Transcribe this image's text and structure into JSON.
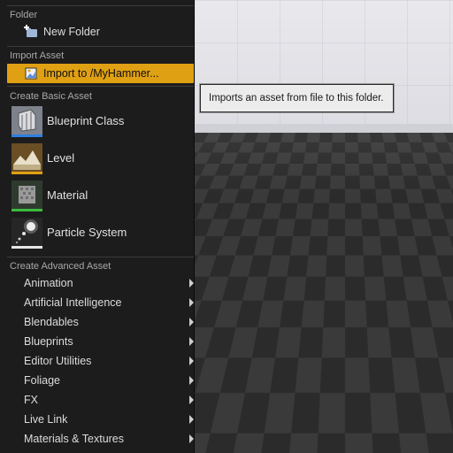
{
  "tooltip": "Imports an asset from file to this folder.",
  "sections": {
    "folder": "Folder",
    "import": "Import Asset",
    "basic": "Create Basic Asset",
    "advanced": "Create Advanced Asset"
  },
  "items": {
    "new_folder": "New Folder",
    "import_to": "Import to /MyHammer..."
  },
  "basic_assets": [
    {
      "label": "Blueprint Class",
      "icon": "blueprint-icon",
      "bar_color": "#2f7fe0"
    },
    {
      "label": "Level",
      "icon": "level-icon",
      "bar_color": "#e0a013"
    },
    {
      "label": "Material",
      "icon": "material-icon",
      "bar_color": "#3dbb3d"
    },
    {
      "label": "Particle System",
      "icon": "particle-icon",
      "bar_color": "#e8e8e8"
    }
  ],
  "advanced_assets": [
    {
      "label": "Animation"
    },
    {
      "label": "Artificial Intelligence"
    },
    {
      "label": "Blendables"
    },
    {
      "label": "Blueprints"
    },
    {
      "label": "Editor Utilities"
    },
    {
      "label": "Foliage"
    },
    {
      "label": "FX"
    },
    {
      "label": "Live Link"
    },
    {
      "label": "Materials & Textures"
    }
  ],
  "colors": {
    "highlight": "#e0a013",
    "panel": "#1c1c1c",
    "tooltip_bg": "#ececec"
  }
}
